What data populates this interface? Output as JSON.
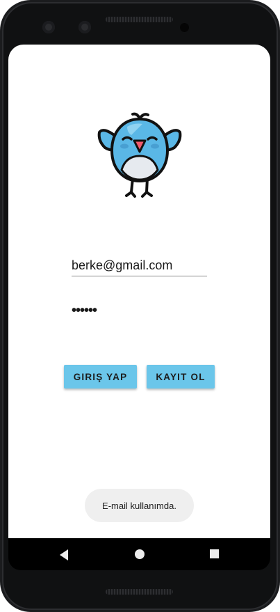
{
  "login": {
    "email_value": "berke@gmail.com",
    "password_masked": "••••••",
    "login_button_label": "GIRIŞ YAP",
    "register_button_label": "KAYIT OL"
  },
  "toast": {
    "message": "E-mail kullanımda."
  },
  "colors": {
    "button": "#6bc6ea",
    "bird_body": "#5ab7e6",
    "bird_beak": "#ef5a6e"
  },
  "icons": {
    "logo": "bird-mascot-icon",
    "nav_back": "back-triangle-icon",
    "nav_home": "home-circle-icon",
    "nav_recents": "recents-square-icon"
  }
}
